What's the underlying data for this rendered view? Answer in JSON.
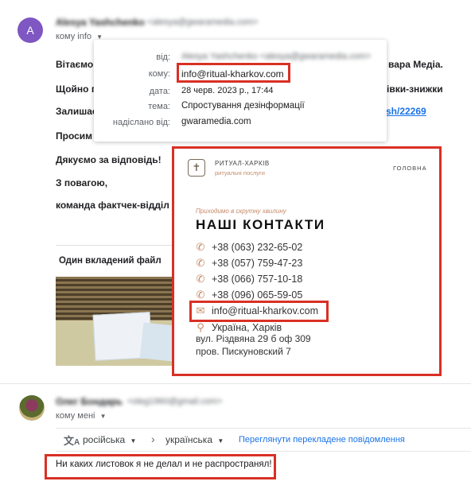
{
  "email1": {
    "sender_name": "Alesya Yashchenko",
    "sender_email": "<alesya@gwaramedia.com>",
    "to_line": "кому info",
    "avatar_letter": "А",
    "body_lines": [
      "Вітаємо",
      "Щойно п",
      "Залишає",
      "Просим",
      "Дякуємо за відповідь!",
      "З повагою,",
      "команда фактчек-відділ"
    ],
    "body_right_1": "вара Медіа.",
    "body_right_2": "івки-знижки",
    "body_link": "sh/22269",
    "attachment_title": "Один вкладений файл"
  },
  "details": {
    "from_label": "від:",
    "from_value": "Alesya Yashchenko <alesya@gwaramedia.com>",
    "to_label": "кому:",
    "to_value": "info@ritual-kharkov.com",
    "date_label": "дата:",
    "date_value": "28 черв. 2023 р., 17:44",
    "subject_label": "тема:",
    "subject_value": "Спростування дезінформації",
    "via_label": "надіслано від:",
    "via_value": "gwaramedia.com"
  },
  "site": {
    "logo_name": "РИТУАЛ-ХАРКІВ",
    "logo_sub": "ритуальні послуги",
    "nav_home": "ГОЛОВНА",
    "tagline": "Приходимо в скрутну хвилину",
    "heading": "НАШІ КОНТАКТИ",
    "phones": [
      "+38 (063) 232-65-02",
      "+38 (057) 759-47-23",
      "+38 (066) 757-10-18",
      "+38 (096) 065-59-05"
    ],
    "email": "info@ritual-kharkov.com",
    "address_lines": [
      "Україна, Харків",
      "вул. Різдвяна 29 б оф 309",
      "пров. Пискуновский 7"
    ]
  },
  "email2": {
    "sender_name": "Олег Бондарь",
    "sender_email": "<oleg1960@gmail.com>",
    "to_line": "кому мені",
    "translate_from": "російська",
    "translate_to": "українська",
    "translate_link": "Переглянути перекладене повідомлення",
    "message": "Ни каких листовок я не делал и не распространял!"
  },
  "colors": {
    "red": "#d93025",
    "avatar1": "#7e57c2",
    "link": "#1a73e8",
    "site_accent": "#c58a68"
  }
}
